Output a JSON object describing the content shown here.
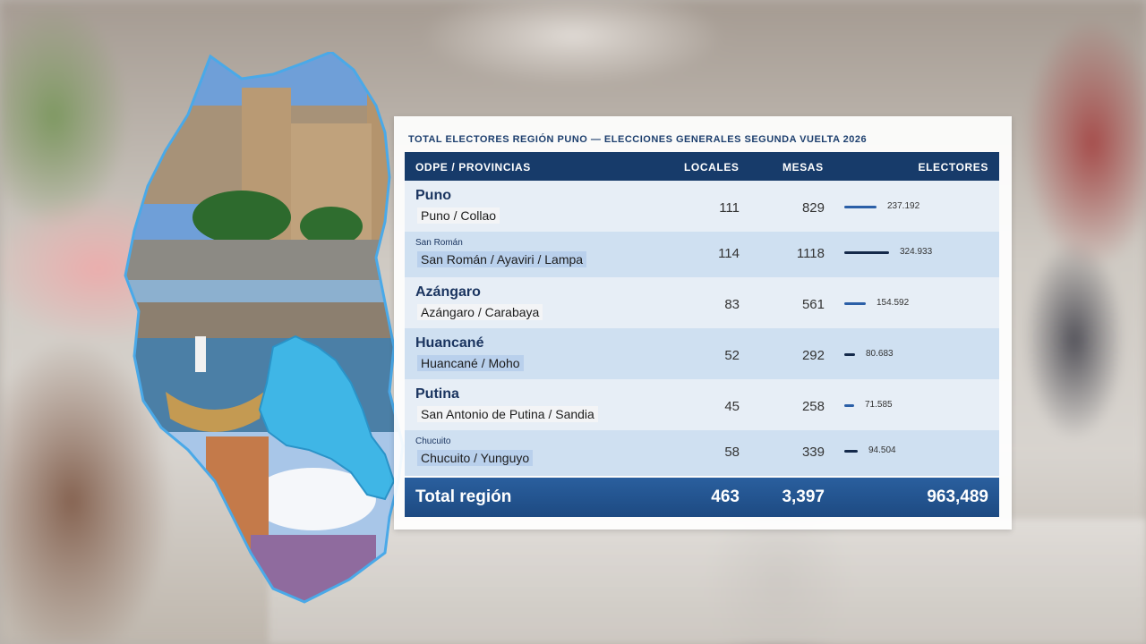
{
  "title": "TOTAL ELECTORES REGIÓN PUNO — ELECCIONES GENERALES SEGUNDA VUELTA 2026",
  "headers": {
    "odpe": "ODPE / PROVINCIAS",
    "locales": "LOCALES",
    "mesas": "MESAS",
    "electores": "ELECTORES"
  },
  "rows": [
    {
      "odpe": "Puno",
      "provinces": "Puno / Collao",
      "locales": "111",
      "mesas": "829",
      "electores": "237.192",
      "electores_value": 237192,
      "name_size": "large"
    },
    {
      "odpe": "San Román",
      "provinces": "San Román / Ayaviri / Lampa",
      "locales": "114",
      "mesas": "1118",
      "electores": "324.933",
      "electores_value": 324933,
      "name_size": "small"
    },
    {
      "odpe": "Azángaro",
      "provinces": "Azángaro / Carabaya",
      "locales": "83",
      "mesas": "561",
      "electores": "154.592",
      "electores_value": 154592,
      "name_size": "large"
    },
    {
      "odpe": "Huancané",
      "provinces": "Huancané / Moho",
      "locales": "52",
      "mesas": "292",
      "electores": "80.683",
      "electores_value": 80683,
      "name_size": "large"
    },
    {
      "odpe": "Putina",
      "provinces": "San Antonio de Putina / Sandia",
      "locales": "45",
      "mesas": "258",
      "electores": "71.585",
      "electores_value": 71585,
      "name_size": "large"
    },
    {
      "odpe": "Chucuito",
      "provinces": "Chucuito / Yunguyo",
      "locales": "58",
      "mesas": "339",
      "electores": "94.504",
      "electores_value": 94504,
      "name_size": "small"
    }
  ],
  "total": {
    "label": "Total región",
    "locales": "463",
    "mesas": "3,397",
    "electores": "963,489"
  },
  "colors": {
    "header_bg": "#173b6a",
    "row_alt": "#cfe0f1",
    "row_plain": "#e7eef6",
    "bar_light": "#2b5fa7",
    "bar_dark": "#14294a",
    "map_lake": "#3fb6e6"
  }
}
